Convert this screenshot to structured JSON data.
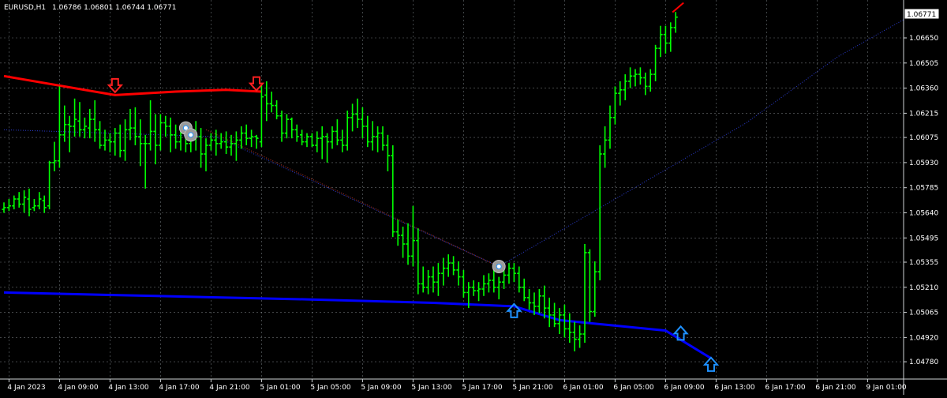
{
  "header": {
    "symbol_label": "EURUSD,H1",
    "ohlc_text": "1.06786 1.06801 1.06744 1.06771"
  },
  "colors": {
    "background": "#000000",
    "grid": "#9aa0a6",
    "bar": "#00ff00",
    "text": "#ffffff",
    "upper_line": "#ff0000",
    "lower_line": "#0000ff",
    "buy_arrow": "#1e90ff",
    "sell_arrow": "#ff2020"
  },
  "chart_data": {
    "type": "ohlc",
    "symbol": "EURUSD",
    "timeframe": "H1",
    "current_price": 1.06771,
    "price_tag": "1.06771",
    "ylim": [
      1.0468,
      1.0686
    ],
    "grid": true,
    "y_ticks": [
      {
        "value": 1.0665,
        "label": "1.06650"
      },
      {
        "value": 1.06505,
        "label": "1.06505"
      },
      {
        "value": 1.0636,
        "label": "1.06360"
      },
      {
        "value": 1.06215,
        "label": "1.06215"
      },
      {
        "value": 1.06075,
        "label": "1.06075"
      },
      {
        "value": 1.0593,
        "label": "1.05930"
      },
      {
        "value": 1.05785,
        "label": "1.05785"
      },
      {
        "value": 1.0564,
        "label": "1.05640"
      },
      {
        "value": 1.05495,
        "label": "1.05495"
      },
      {
        "value": 1.05355,
        "label": "1.05355"
      },
      {
        "value": 1.0521,
        "label": "1.05210"
      },
      {
        "value": 1.05065,
        "label": "1.05065"
      },
      {
        "value": 1.0492,
        "label": "1.04920"
      },
      {
        "value": 1.0478,
        "label": "1.04780"
      }
    ],
    "x_ticks": [
      {
        "bar": 1,
        "label": "4 Jan 2023"
      },
      {
        "bar": 11,
        "label": "4 Jan 09:00"
      },
      {
        "bar": 21,
        "label": "4 Jan 13:00"
      },
      {
        "bar": 31,
        "label": "4 Jan 17:00"
      },
      {
        "bar": 41,
        "label": "4 Jan 21:00"
      },
      {
        "bar": 51,
        "label": "5 Jan 01:00"
      },
      {
        "bar": 61,
        "label": "5 Jan 05:00"
      },
      {
        "bar": 71,
        "label": "5 Jan 09:00"
      },
      {
        "bar": 81,
        "label": "5 Jan 13:00"
      },
      {
        "bar": 91,
        "label": "5 Jan 17:00"
      },
      {
        "bar": 101,
        "label": "5 Jan 21:00"
      },
      {
        "bar": 111,
        "label": "6 Jan 01:00"
      },
      {
        "bar": 121,
        "label": "6 Jan 05:00"
      },
      {
        "bar": 131,
        "label": "6 Jan 09:00"
      },
      {
        "bar": 141,
        "label": "6 Jan 13:00"
      },
      {
        "bar": 151,
        "label": "6 Jan 17:00"
      },
      {
        "bar": 161,
        "label": "6 Jan 21:00"
      },
      {
        "bar": 171,
        "label": "9 Jan 01:00"
      }
    ],
    "bars": [
      [
        1.0566,
        1.057,
        1.0564,
        1.0567
      ],
      [
        1.0567,
        1.0572,
        1.0565,
        1.0568
      ],
      [
        1.0568,
        1.0574,
        1.0566,
        1.0572
      ],
      [
        1.0572,
        1.0576,
        1.0567,
        1.0569
      ],
      [
        1.0569,
        1.0577,
        1.0564,
        1.0573
      ],
      [
        1.0572,
        1.0578,
        1.0562,
        1.0566
      ],
      [
        1.0567,
        1.0572,
        1.0565,
        1.0568
      ],
      [
        1.0568,
        1.0576,
        1.0566,
        1.0572
      ],
      [
        1.0571,
        1.0574,
        1.0564,
        1.0567
      ],
      [
        1.0568,
        1.0594,
        1.0566,
        1.0593
      ],
      [
        1.0593,
        1.0605,
        1.0588,
        1.0594
      ],
      [
        1.0594,
        1.0637,
        1.059,
        1.0609
      ],
      [
        1.0609,
        1.0626,
        1.0605,
        1.0615
      ],
      [
        1.0615,
        1.062,
        1.0599,
        1.0614
      ],
      [
        1.0614,
        1.063,
        1.0608,
        1.0618
      ],
      [
        1.0617,
        1.0628,
        1.0608,
        1.0612
      ],
      [
        1.0612,
        1.0619,
        1.0607,
        1.0614
      ],
      [
        1.0613,
        1.0624,
        1.0607,
        1.0618
      ],
      [
        1.0618,
        1.0629,
        1.0605,
        1.0612
      ],
      [
        1.0612,
        1.0617,
        1.0601,
        1.0603
      ],
      [
        1.0603,
        1.0612,
        1.06,
        1.0606
      ],
      [
        1.0606,
        1.061,
        1.0599,
        1.0605
      ],
      [
        1.0605,
        1.0613,
        1.0597,
        1.061
      ],
      [
        1.061,
        1.0615,
        1.0596,
        1.06
      ],
      [
        1.06,
        1.0618,
        1.0594,
        1.0612
      ],
      [
        1.0612,
        1.0624,
        1.0606,
        1.0613
      ],
      [
        1.0613,
        1.0625,
        1.0603,
        1.0608
      ],
      [
        1.0608,
        1.0618,
        1.0591,
        1.0604
      ],
      [
        1.0604,
        1.0609,
        1.0578,
        1.0604
      ],
      [
        1.0604,
        1.0629,
        1.06,
        1.0611
      ],
      [
        1.0611,
        1.0621,
        1.0592,
        1.0603
      ],
      [
        1.0603,
        1.0621,
        1.06,
        1.0616
      ],
      [
        1.0616,
        1.062,
        1.0608,
        1.0614
      ],
      [
        1.0614,
        1.0619,
        1.0599,
        1.0609
      ],
      [
        1.0609,
        1.0615,
        1.0601,
        1.0605
      ],
      [
        1.0605,
        1.0614,
        1.06,
        1.061
      ],
      [
        1.061,
        1.0613,
        1.0599,
        1.0604
      ],
      [
        1.0604,
        1.0611,
        1.0599,
        1.0607
      ],
      [
        1.0607,
        1.0617,
        1.06,
        1.0608
      ],
      [
        1.0608,
        1.0613,
        1.059,
        1.0598
      ],
      [
        1.0598,
        1.0607,
        1.0588,
        1.0603
      ],
      [
        1.0603,
        1.061,
        1.06,
        1.0606
      ],
      [
        1.0606,
        1.0612,
        1.0597,
        1.0604
      ],
      [
        1.0604,
        1.061,
        1.0601,
        1.0605
      ],
      [
        1.0605,
        1.0611,
        1.0598,
        1.0602
      ],
      [
        1.0602,
        1.0609,
        1.0597,
        1.0604
      ],
      [
        1.0604,
        1.0611,
        1.0594,
        1.0606
      ],
      [
        1.0606,
        1.0614,
        1.0601,
        1.061
      ],
      [
        1.061,
        1.0615,
        1.0603,
        1.0607
      ],
      [
        1.0607,
        1.0612,
        1.0602,
        1.0608
      ],
      [
        1.0608,
        1.0609,
        1.0601,
        1.0607
      ],
      [
        1.0605,
        1.0638,
        1.0602,
        1.0631
      ],
      [
        1.0632,
        1.064,
        1.0617,
        1.0627
      ],
      [
        1.0627,
        1.0634,
        1.0622,
        1.0626
      ],
      [
        1.0626,
        1.0629,
        1.0618,
        1.062
      ],
      [
        1.062,
        1.0623,
        1.0605,
        1.061
      ],
      [
        1.061,
        1.0621,
        1.0607,
        1.0618
      ],
      [
        1.0618,
        1.0619,
        1.0607,
        1.0612
      ],
      [
        1.0612,
        1.0615,
        1.0605,
        1.0608
      ],
      [
        1.0609,
        1.0612,
        1.0603,
        1.0605
      ],
      [
        1.0605,
        1.061,
        1.0602,
        1.0608
      ],
      [
        1.0608,
        1.061,
        1.0602,
        1.0603
      ],
      [
        1.0603,
        1.0611,
        1.0599,
        1.0607
      ],
      [
        1.0607,
        1.0614,
        1.0595,
        1.0608
      ],
      [
        1.0608,
        1.061,
        1.0593,
        1.0605
      ],
      [
        1.0605,
        1.0614,
        1.0601,
        1.0611
      ],
      [
        1.0611,
        1.0618,
        1.0603,
        1.0606
      ],
      [
        1.0606,
        1.0612,
        1.0599,
        1.0603
      ],
      [
        1.0603,
        1.0623,
        1.06,
        1.0619
      ],
      [
        1.0619,
        1.0627,
        1.0611,
        1.0621
      ],
      [
        1.0621,
        1.063,
        1.0613,
        1.0618
      ],
      [
        1.0618,
        1.0625,
        1.0607,
        1.0614
      ],
      [
        1.0614,
        1.062,
        1.0602,
        1.0605
      ],
      [
        1.0605,
        1.0617,
        1.06,
        1.0608
      ],
      [
        1.0608,
        1.0614,
        1.0599,
        1.061
      ],
      [
        1.061,
        1.0614,
        1.06,
        1.0603
      ],
      [
        1.0603,
        1.0609,
        1.0588,
        1.0597
      ],
      [
        1.0597,
        1.0603,
        1.055,
        1.0553
      ],
      [
        1.0553,
        1.056,
        1.0545,
        1.0551
      ],
      [
        1.0551,
        1.0556,
        1.0538,
        1.0546
      ],
      [
        1.0546,
        1.0558,
        1.0534,
        1.0539
      ],
      [
        1.0539,
        1.0568,
        1.0533,
        1.0548
      ],
      [
        1.0548,
        1.0555,
        1.0517,
        1.0523
      ],
      [
        1.0523,
        1.0533,
        1.0518,
        1.0521
      ],
      [
        1.0521,
        1.0531,
        1.0517,
        1.0527
      ],
      [
        1.0527,
        1.0533,
        1.0518,
        1.0524
      ],
      [
        1.0524,
        1.0535,
        1.0516,
        1.0529
      ],
      [
        1.0529,
        1.0538,
        1.0522,
        1.0532
      ],
      [
        1.0532,
        1.054,
        1.0527,
        1.0535
      ],
      [
        1.0535,
        1.0539,
        1.0528,
        1.0531
      ],
      [
        1.0531,
        1.0536,
        1.0522,
        1.0527
      ],
      [
        1.0527,
        1.0531,
        1.0515,
        1.0518
      ],
      [
        1.0518,
        1.0524,
        1.0509,
        1.0521
      ],
      [
        1.0521,
        1.0525,
        1.0516,
        1.0519
      ],
      [
        1.0519,
        1.0524,
        1.0513,
        1.052
      ],
      [
        1.052,
        1.0528,
        1.0516,
        1.0523
      ],
      [
        1.0523,
        1.0529,
        1.0518,
        1.0525
      ],
      [
        1.0525,
        1.0533,
        1.0518,
        1.0521
      ],
      [
        1.0521,
        1.0527,
        1.0514,
        1.0524
      ],
      [
        1.0524,
        1.0531,
        1.052,
        1.0528
      ],
      [
        1.0528,
        1.0535,
        1.0523,
        1.0532
      ],
      [
        1.0532,
        1.0535,
        1.0524,
        1.0529
      ],
      [
        1.0529,
        1.0533,
        1.0518,
        1.0521
      ],
      [
        1.0521,
        1.0526,
        1.0513,
        1.0515
      ],
      [
        1.0515,
        1.052,
        1.0508,
        1.0512
      ],
      [
        1.0512,
        1.0518,
        1.0505,
        1.051
      ],
      [
        1.051,
        1.052,
        1.0506,
        1.0516
      ],
      [
        1.0516,
        1.0522,
        1.0503,
        1.0509
      ],
      [
        1.0509,
        1.0515,
        1.0498,
        1.0505
      ],
      [
        1.0505,
        1.0512,
        1.0498,
        1.05
      ],
      [
        1.05,
        1.0509,
        1.0494,
        1.0505
      ],
      [
        1.0505,
        1.0511,
        1.0492,
        1.0497
      ],
      [
        1.0497,
        1.0506,
        1.0489,
        1.0495
      ],
      [
        1.0495,
        1.0501,
        1.0484,
        1.0491
      ],
      [
        1.0491,
        1.0499,
        1.0486,
        1.0494
      ],
      [
        1.0494,
        1.0546,
        1.0489,
        1.0541
      ],
      [
        1.0541,
        1.0543,
        1.0501,
        1.0507
      ],
      [
        1.0507,
        1.0536,
        1.0504,
        1.053
      ],
      [
        1.053,
        1.0603,
        1.0525,
        1.0598
      ],
      [
        1.0598,
        1.0614,
        1.059,
        1.0606
      ],
      [
        1.0606,
        1.0626,
        1.0601,
        1.0619
      ],
      [
        1.0619,
        1.0637,
        1.0615,
        1.0633
      ],
      [
        1.0633,
        1.064,
        1.0626,
        1.0635
      ],
      [
        1.0635,
        1.0644,
        1.0629,
        1.064
      ],
      [
        1.064,
        1.0648,
        1.0636,
        1.0643
      ],
      [
        1.0643,
        1.0647,
        1.0637,
        1.0644
      ],
      [
        1.0644,
        1.0648,
        1.0638,
        1.0642
      ],
      [
        1.0642,
        1.0645,
        1.0632,
        1.0637
      ],
      [
        1.0637,
        1.0647,
        1.0634,
        1.0644
      ],
      [
        1.0644,
        1.0661,
        1.064,
        1.0659
      ],
      [
        1.0659,
        1.0672,
        1.0654,
        1.0667
      ],
      [
        1.0667,
        1.0672,
        1.0656,
        1.0662
      ],
      [
        1.0662,
        1.0674,
        1.0657,
        1.0671
      ],
      [
        1.0671,
        1.068,
        1.0668,
        1.0677
      ]
    ],
    "overlays": {
      "upper_line": [
        [
          0,
          1.0643
        ],
        [
          22,
          1.0632
        ],
        [
          34,
          1.0634
        ],
        [
          44,
          1.0635
        ],
        [
          51,
          1.0634
        ]
      ],
      "lower_line": [
        [
          0,
          1.0518
        ],
        [
          30,
          1.0516
        ],
        [
          60,
          1.0514
        ],
        [
          85,
          1.0512
        ],
        [
          101,
          1.051
        ],
        [
          110,
          1.0502
        ],
        [
          131,
          1.0496
        ],
        [
          140,
          1.048
        ]
      ],
      "dotted_red": [
        [
          40,
          1.0612
        ],
        [
          98,
          1.0533
        ]
      ],
      "dotted_blue": [
        [
          0,
          1.0612
        ],
        [
          42,
          1.0608
        ],
        [
          98,
          1.0533
        ],
        [
          147,
          1.0616
        ],
        [
          165,
          1.0654
        ],
        [
          179,
          1.0677
        ]
      ]
    },
    "markers": [
      {
        "type": "sell-arrow",
        "bar": 22,
        "price": 1.0635
      },
      {
        "type": "sell-arrow",
        "bar": 50,
        "price": 1.0636
      },
      {
        "type": "buy-arrow",
        "bar": 101,
        "price": 1.051
      },
      {
        "type": "buy-arrow",
        "bar": 134,
        "price": 1.0497
      },
      {
        "type": "buy-arrow",
        "bar": 140,
        "price": 1.0479
      },
      {
        "type": "signal-circle",
        "bar": 36,
        "price": 1.0613
      },
      {
        "type": "signal-circle",
        "bar": 37,
        "price": 1.0609
      },
      {
        "type": "signal-circle",
        "bar": 98,
        "price": 1.0533
      }
    ]
  }
}
